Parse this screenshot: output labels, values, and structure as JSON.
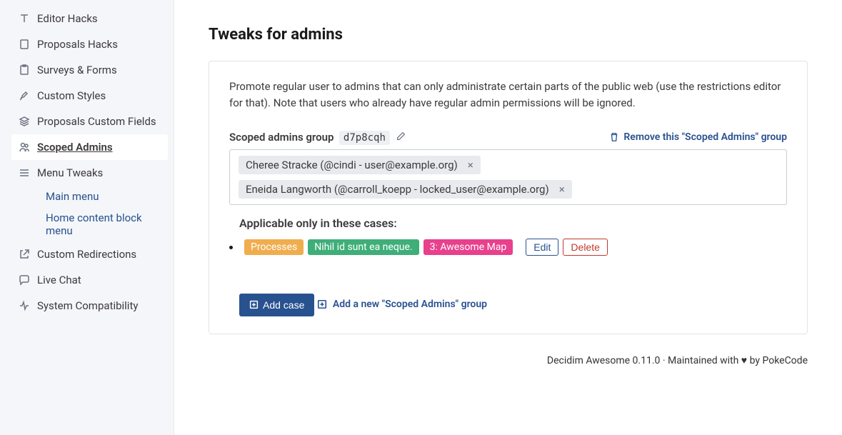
{
  "sidebar": {
    "items": [
      {
        "label": "Editor Hacks"
      },
      {
        "label": "Proposals Hacks"
      },
      {
        "label": "Surveys & Forms"
      },
      {
        "label": "Custom Styles"
      },
      {
        "label": "Proposals Custom Fields"
      },
      {
        "label": "Scoped Admins"
      },
      {
        "label": "Menu Tweaks"
      },
      {
        "label": "Custom Redirections"
      },
      {
        "label": "Live Chat"
      },
      {
        "label": "System Compatibility"
      }
    ],
    "sub": [
      {
        "label": "Main menu"
      },
      {
        "label": "Home content block menu"
      }
    ]
  },
  "page": {
    "title": "Tweaks for admins",
    "intro": "Promote regular user to admins that can only administrate certain parts of the public web (use the restrictions editor for that). Note that users who already have regular admin permissions will be ignored."
  },
  "group": {
    "label": "Scoped admins group",
    "code": "d7p8cqh",
    "remove": "Remove this \"Scoped Admins\" group",
    "chips": [
      "Cheree Stracke (@cindi - user@example.org)",
      "Eneida Langworth (@carroll_koepp - locked_user@example.org)"
    ],
    "applicable": "Applicable only in these cases:",
    "tags": [
      {
        "label": "Processes",
        "cls": "orange"
      },
      {
        "label": "Nihil id sunt ea neque.",
        "cls": "green"
      },
      {
        "label": "3: Awesome Map",
        "cls": "pink"
      }
    ],
    "edit": "Edit",
    "delete": "Delete",
    "add_case": "Add case"
  },
  "add_group": "Add a new \"Scoped Admins\" group",
  "footer": "Decidim Awesome 0.11.0 · Maintained with ♥ by PokeCode"
}
